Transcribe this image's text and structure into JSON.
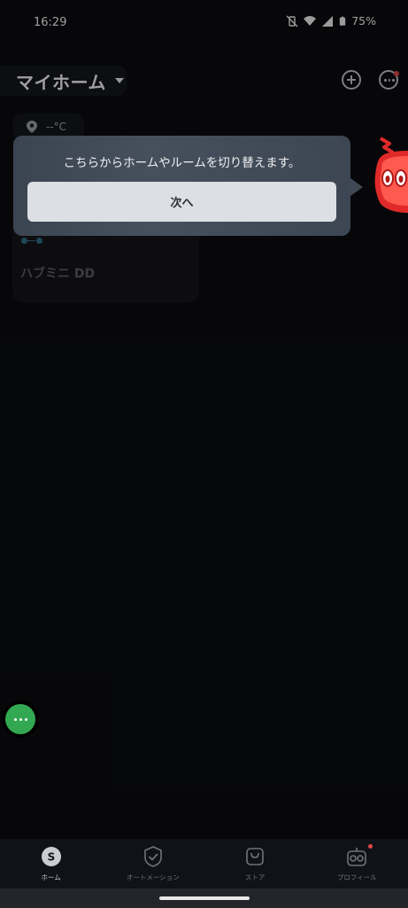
{
  "status_bar": {
    "time": "16:29",
    "battery": "75%"
  },
  "header": {
    "home_name": "マイホーム"
  },
  "weather": {
    "temperature": "--°C"
  },
  "device_card": {
    "name": "ハブミニ DD"
  },
  "tooltip": {
    "message": "こちらからホームやルームを切り替えます。",
    "next_label": "次へ"
  },
  "bottom_nav": {
    "items": [
      {
        "label": "ホーム",
        "icon": "home-s-icon",
        "active": true
      },
      {
        "label": "オートメーション",
        "icon": "automation-check-icon",
        "active": false
      },
      {
        "label": "ストア",
        "icon": "store-bag-icon",
        "active": false
      },
      {
        "label": "プロフィール",
        "icon": "profile-robot-icon",
        "active": false
      }
    ]
  },
  "colors": {
    "background": "#0b0c10",
    "fab": "#33a852",
    "badge": "#e04848",
    "tooltip": "#434c59"
  }
}
